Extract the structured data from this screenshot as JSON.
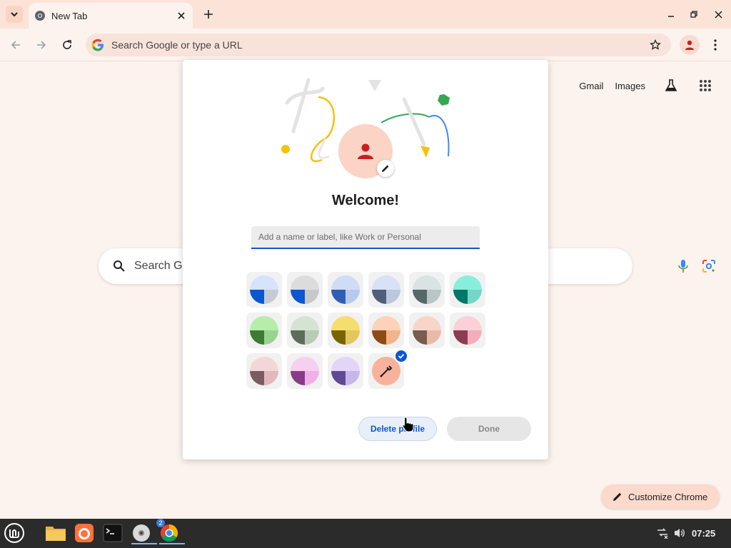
{
  "tab": {
    "title": "New Tab"
  },
  "omnibox": {
    "placeholder": "Search Google or type a URL"
  },
  "ntp": {
    "links": [
      "Gmail",
      "Images"
    ],
    "search_placeholder": "Search G",
    "customize_label": "Customize Chrome"
  },
  "dialog": {
    "title": "Welcome!",
    "name_placeholder": "Add a name or label, like Work or Personal",
    "delete_label": "Delete profile",
    "done_label": "Done",
    "selected_color": "custom",
    "colors": [
      {
        "tl": "#d7e3fb",
        "tr": "#d7e3fb",
        "bl": "#0b57d0",
        "br": "#c6cbd3"
      },
      {
        "tl": "#dcdcdc",
        "tr": "#dcdcdc",
        "bl": "#0b57d0",
        "br": "#c8c8c8"
      },
      {
        "tl": "#d0dcf6",
        "tr": "#d0dcf6",
        "bl": "#2e5fb4",
        "br": "#b7c9ee"
      },
      {
        "tl": "#d8e2f6",
        "tr": "#d8e2f6",
        "bl": "#515e7a",
        "br": "#bcc7dc"
      },
      {
        "tl": "#d9e3e3",
        "tr": "#d9e3e3",
        "bl": "#566868",
        "br": "#b8c6c6"
      },
      {
        "tl": "#88eedc",
        "tr": "#88eedc",
        "bl": "#00786a",
        "br": "#73d7c7"
      },
      {
        "tl": "#b6edab",
        "tr": "#b6edab",
        "bl": "#3e7a35",
        "br": "#98d48f"
      },
      {
        "tl": "#d5e3d3",
        "tr": "#d5e3d3",
        "bl": "#5d6d5b",
        "br": "#b9cab6"
      },
      {
        "tl": "#f6dd70",
        "tr": "#f6dd70",
        "bl": "#7a6400",
        "br": "#e2c85a"
      },
      {
        "tl": "#fcd3b9",
        "tr": "#fcd3b9",
        "bl": "#8d4b14",
        "br": "#f3b48a"
      },
      {
        "tl": "#f7d6c9",
        "tr": "#f7d6c9",
        "bl": "#7a5b50",
        "br": "#e7baa9"
      },
      {
        "tl": "#fbd0d8",
        "tr": "#fbd0d8",
        "bl": "#8c3c52",
        "br": "#f3adbc"
      },
      {
        "tl": "#f4d5d8",
        "tr": "#f4d5d8",
        "bl": "#7a5c60",
        "br": "#e2b8bc"
      },
      {
        "tl": "#f7cff1",
        "tr": "#f7cff1",
        "bl": "#8a3b86",
        "br": "#eeb0e6"
      },
      {
        "tl": "#e1d6f8",
        "tr": "#e1d6f8",
        "bl": "#5f4b94",
        "br": "#c7b6ee"
      }
    ]
  },
  "taskbar": {
    "clock": "07:25",
    "chrome_badge": "2",
    "apps": [
      "menu-icon",
      "files-icon",
      "firefox-icon",
      "terminal-icon",
      "disc-icon",
      "chrome-icon"
    ]
  },
  "theme": {
    "accent": "#0b57d0",
    "tabstrip_bg": "#fbe3d8",
    "page_bg": "#fdf3ee"
  }
}
